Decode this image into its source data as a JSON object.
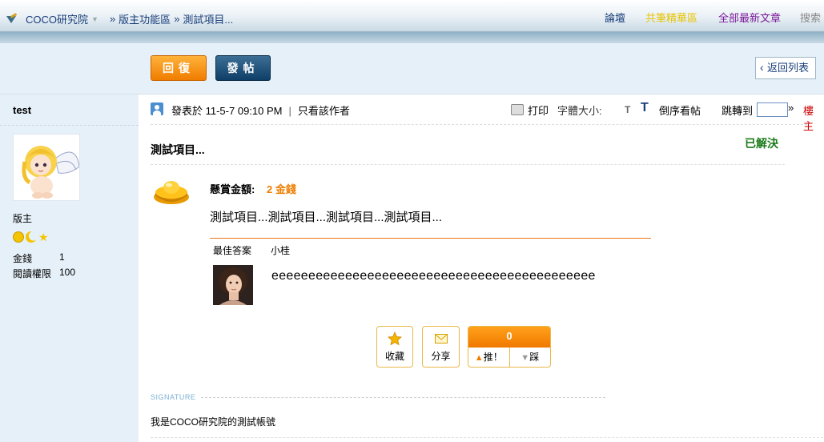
{
  "header": {
    "breadcrumb": [
      "COCO研究院",
      "版主功能區",
      "測試項目..."
    ],
    "breadcrumb_sep": "»",
    "nav": {
      "forum": "論壇",
      "essence": "共筆精華區",
      "latest": "全部最新文章",
      "search": "搜索"
    }
  },
  "toolbar": {
    "reply_label": "回復",
    "post_label": "發帖",
    "back_label": "返回列表"
  },
  "author": {
    "name": "test",
    "rank": "版主",
    "stats": [
      {
        "label": "金錢",
        "value": "1"
      },
      {
        "label": "閱讀權限",
        "value": "100"
      }
    ]
  },
  "post": {
    "posted_at": "發表於 11-5-7 09:10 PM",
    "bar": "|",
    "only_author": "只看該作者",
    "print": "打印",
    "font_size": "字體大小:",
    "font_small": "T",
    "font_large": "T",
    "reverse": "倒序看帖",
    "jump_to": "跳轉到",
    "jump_go": "»",
    "floor": "樓主",
    "title": "測試項目...",
    "status": "已解決",
    "reward_label": "懸賞金額:",
    "reward_amount": "2 金錢",
    "body": "測試項目...測試項目...測試項目...測試項目...",
    "best_answer_label": "最佳答案",
    "best_answer_user": "小桂",
    "best_answer_text": "eeeeeeeeeeeeeeeeeeeeeeeeeeeeeeeeeeeeeeeeeeee",
    "actions": {
      "favorite": "收藏",
      "share": "分享",
      "vote_count": "0",
      "vote_up": "推！",
      "vote_down": "踩"
    },
    "signature_label": "SIGNATURE",
    "signature": "我是COCO研究院的測試帳號"
  },
  "colors": {
    "accent_orange": "#f07d00",
    "solved_green": "#1a7a1a",
    "link_blue": "#1a3f7a",
    "floor_red": "#cc0000"
  }
}
